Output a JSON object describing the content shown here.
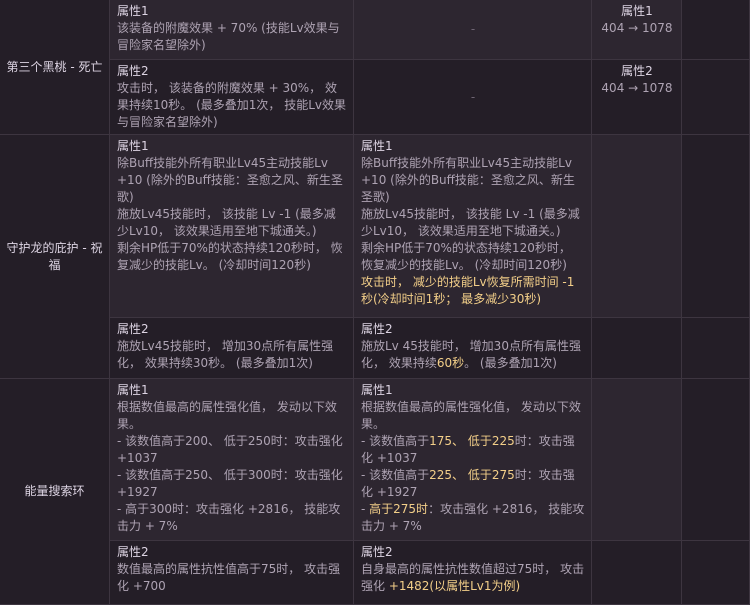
{
  "rows": {
    "black_peach": {
      "name": "第三个黑桃 - 死亡",
      "attr1": {
        "label": "属性1",
        "text": "该装备的附魔效果 + 70% (技能Lv效果与冒险家名望除外)",
        "new": "-",
        "stat_label": "属性1",
        "stat_value": "404 → 1078"
      },
      "attr2": {
        "label": "属性2",
        "text": "攻击时， 该装备的附魔效果 + 30%， 效果持续10秒。 (最多叠加1次， 技能Lv效果与冒险家名望除外)",
        "new": "-",
        "stat_label": "属性2",
        "stat_value": "404 → 1078"
      }
    },
    "dragon_guard": {
      "name": "守护龙的庇护 - 祝福",
      "attr1": {
        "label": "属性1",
        "text": "除Buff技能外所有职业Lv45主动技能Lv +10 (除外的Buff技能：圣愈之风、新生圣歌)\n施放Lv45技能时， 该技能 Lv -1 (最多减少Lv10， 该效果适用至地下城通关。)\n剩余HP低于70%的状态持续120秒时， 恢复减少的技能Lv。 (冷却时间120秒)",
        "new_label": "属性1",
        "new_text": "除Buff技能外所有职业Lv45主动技能Lv +10 (除外的Buff技能：圣愈之风、新生圣歌)\n施放Lv45技能时， 该技能 Lv -1 (最多减少Lv10， 该效果适用至地下城通关。)\n剩余HP低于70%的状态持续120秒时， 恢复减少的技能Lv。 (冷却时间120秒)",
        "new_hl": "攻击时， 减少的技能Lv恢复所需时间 -1秒(冷却时间1秒； 最多减少30秒)"
      },
      "attr2": {
        "label": "属性2",
        "text": "施放Lv45技能时， 增加30点所有属性强化， 效果持续30秒。 (最多叠加1次)",
        "new_label": "属性2",
        "new_pre": "施放Lv 45技能时， 增加30点所有属性强化， 效果持续",
        "new_hl": "60秒",
        "new_post": "。 (最多叠加1次)"
      }
    },
    "energy_ring": {
      "name": "能量搜索环",
      "attr1": {
        "label": "属性1",
        "text": "根据数值最高的属性强化值， 发动以下效果。\n- 该数值高于200、 低于250时：攻击强化 +1037\n- 该数值高于250、 低于300时：攻击强化 +1927\n- 高于300时：攻击强化 +2816， 技能攻击力 + 7%",
        "new_label": "属性1",
        "new_intro": "根据数值最高的属性强化值， 发动以下效果。",
        "l1_pre": "- 该数值高于",
        "l1_hl": "175、 低于225",
        "l1_post": "时：攻击强化 +1037",
        "l2_pre": "- 该数值高于",
        "l2_hl": "225、 低于275",
        "l2_post": "时：攻击强化 +1927",
        "l3_pre": "- ",
        "l3_hl": "高于275时",
        "l3_post": "：攻击强化 +2816， 技能攻击力 + 7%"
      },
      "attr2": {
        "label": "属性2",
        "text": "数值最高的属性抗性值高于75时， 攻击强化 +700",
        "new_label": "属性2",
        "new_pre": "自身最高的属性抗性数值超过75时， 攻击强化 ",
        "new_hl": "+1482(以属性Lv1为例)"
      }
    }
  }
}
